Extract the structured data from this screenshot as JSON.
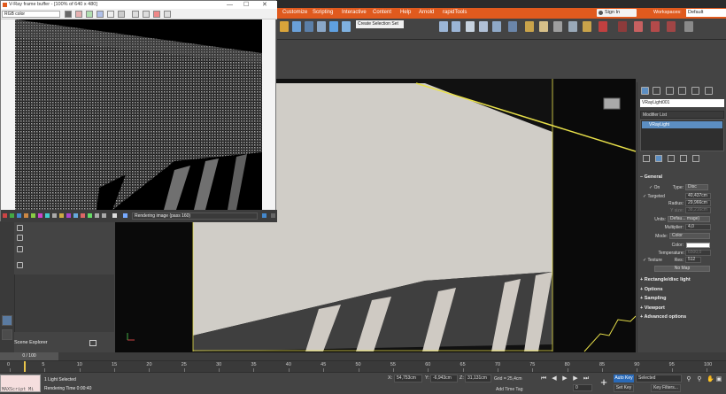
{
  "menu": {
    "items": [
      "Customize",
      "Scripting",
      "Interactive",
      "Content",
      "Help",
      "Arnold",
      "rapidTools"
    ],
    "signin": "Sign In",
    "workspaces_label": "Workspaces:",
    "workspace_value": "Default"
  },
  "toolbar": {
    "selection_set_placeholder": "Create Selection Set"
  },
  "frame_buffer": {
    "title": "V-Ray frame buffer - [100% of 640 x 480]",
    "channel": "RGB color",
    "status": "Rendering image (pass 160)",
    "win_min": "—",
    "win_max": "☐",
    "win_close": "✕"
  },
  "left_panel": {
    "scene_explorer": "Scene Explorer"
  },
  "right_panel": {
    "object_name": "VRayLight001",
    "modifier_list": "Modifier List",
    "stack_item": "VRayLight",
    "general": {
      "title": "General",
      "on_label": "On",
      "type_label": "Type:",
      "type_value": "Disc",
      "targeted_label": "Targeted",
      "targeted_value": "40,437cm",
      "radius_label": "Radius:",
      "radius_value": "29,966cm",
      "ysize_label": "Y size:",
      "ysize_value": "38,216cm",
      "units_label": "Units:",
      "units_value": "Defau... mage)",
      "multiplier_label": "Multiplier:",
      "multiplier_value": "4,0",
      "mode_label": "Mode:",
      "mode_value": "Color",
      "color_label": "Color:",
      "temperature_label": "Temperature:",
      "temperature_value": "6500,0",
      "texture_label": "Texture",
      "res_label": "Res:",
      "res_value": "512",
      "nomap": "No Map"
    },
    "rollouts": [
      "Rectangle/disc light",
      "Options",
      "Sampling",
      "Viewport",
      "Advanced options"
    ]
  },
  "timeline": {
    "slider": "0 / 100",
    "ticks": [
      "0",
      "5",
      "10",
      "15",
      "20",
      "25",
      "30",
      "35",
      "40",
      "45",
      "50",
      "55",
      "60",
      "65",
      "70",
      "75",
      "80",
      "85",
      "90",
      "95",
      "100"
    ]
  },
  "status": {
    "maxscript": "MAXScript Mi",
    "line1": "1 Light Selected",
    "line2": "Rendering Time  0:00:40",
    "x_label": "X:",
    "x_value": "54,753cm",
    "y_label": "Y:",
    "y_value": "-6,943cm",
    "z_label": "Z:",
    "z_value": "31,131cm",
    "grid": "Grid = 25,4cm",
    "add_time_tag": "Add Time Tag",
    "auto_key": "Auto Key",
    "set_key": "Set Key",
    "selected": "Selected",
    "key_filters": "Key Filters...",
    "frame": "0"
  },
  "colors": {
    "accent": "#e05a1e",
    "selection": "#5c8ec2",
    "highlight": "#e8e04a"
  }
}
